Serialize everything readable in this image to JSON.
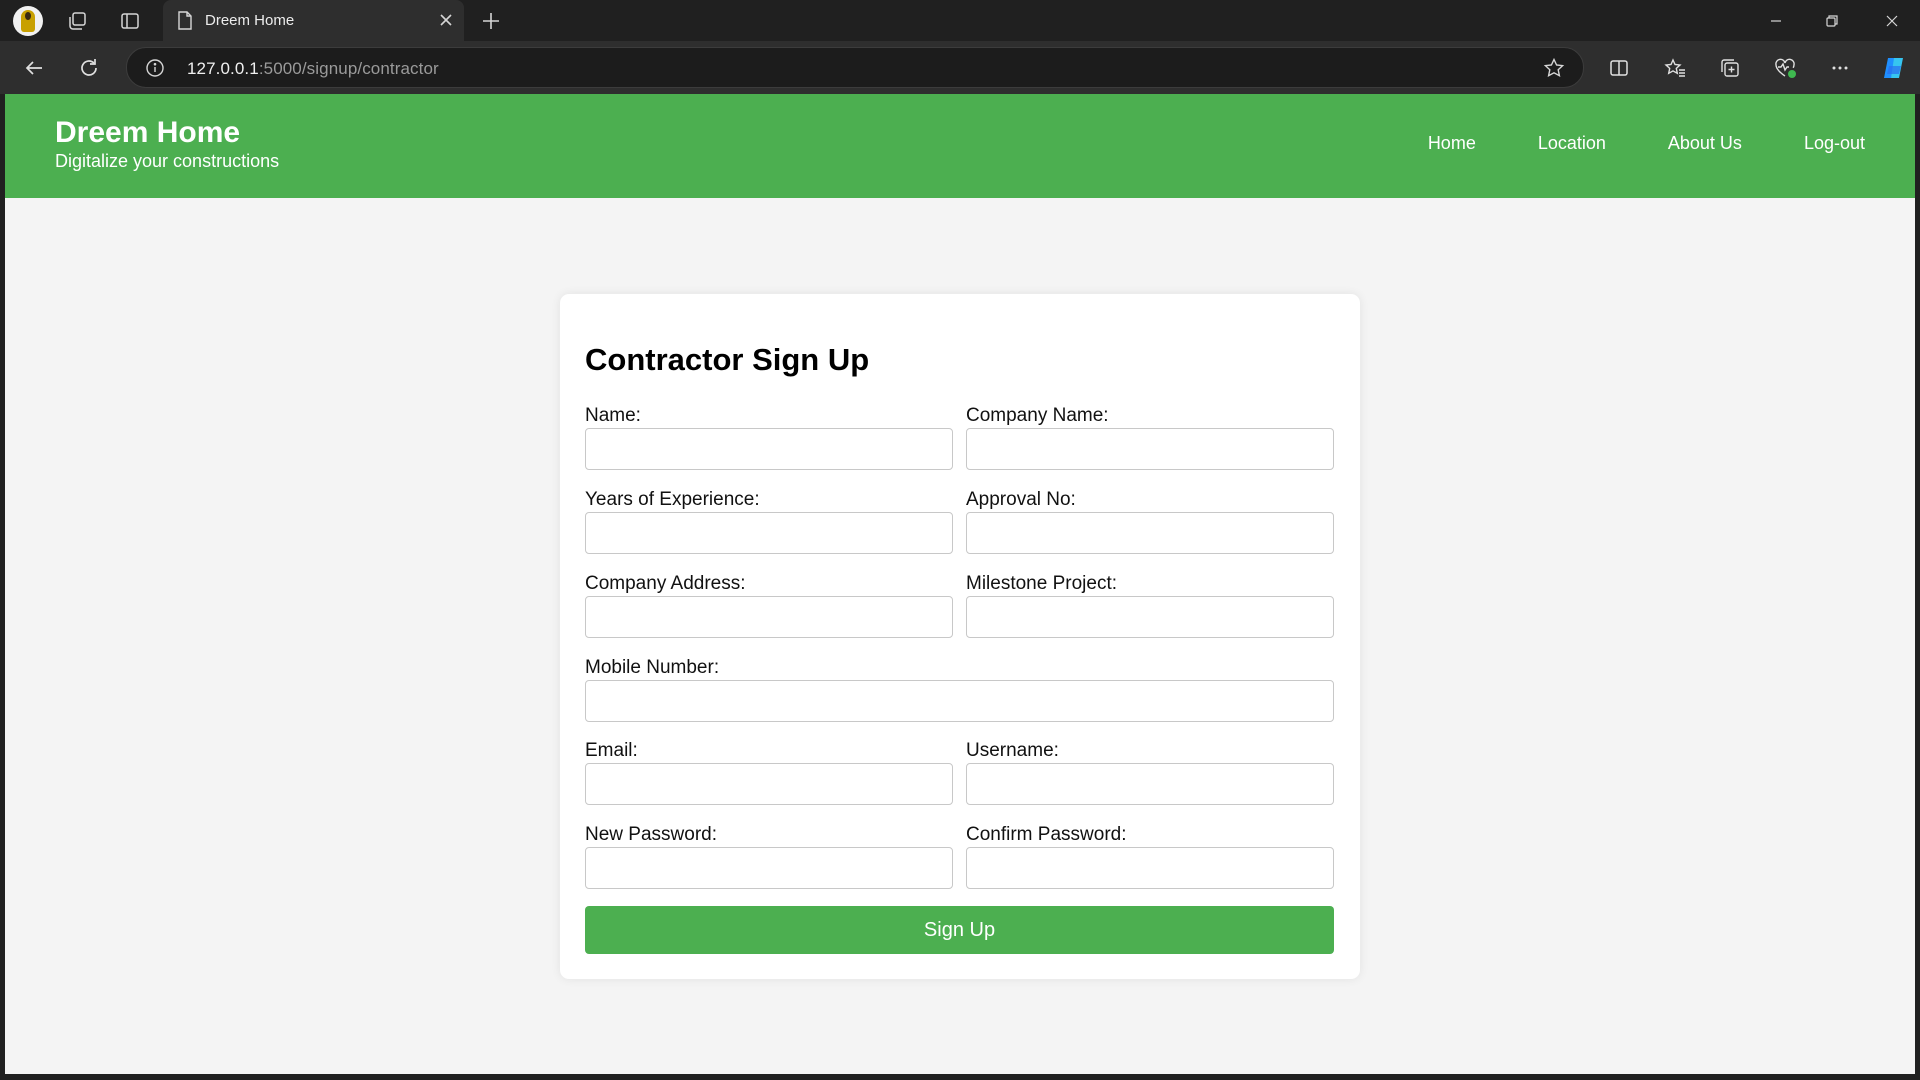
{
  "browser": {
    "tab_title": "Dreem Home",
    "url_host": "127.0.0.1",
    "url_rest": ":5000/signup/contractor"
  },
  "site": {
    "brand_title": "Dreem Home",
    "brand_subtitle": "Digitalize your constructions",
    "nav": [
      "Home",
      "Location",
      "About Us",
      "Log-out"
    ]
  },
  "form": {
    "title": "Contractor Sign Up",
    "labels": {
      "name": "Name:",
      "company_name": "Company Name:",
      "years_experience": "Years of Experience:",
      "approval_no": "Approval No:",
      "company_address": "Company Address:",
      "milestone_project": "Milestone Project:",
      "mobile": "Mobile Number:",
      "email": "Email:",
      "username": "Username:",
      "new_password": "New Password:",
      "confirm_password": "Confirm Password:"
    },
    "values": {
      "name": "",
      "company_name": "",
      "years_experience": "",
      "approval_no": "",
      "company_address": "",
      "milestone_project": "",
      "mobile": "",
      "email": "",
      "username": "",
      "new_password": "",
      "confirm_password": ""
    },
    "submit_label": "Sign Up"
  },
  "colors": {
    "brand_green": "#4caf50",
    "page_bg": "#f4f4f4",
    "chrome_dark": "#202020"
  }
}
